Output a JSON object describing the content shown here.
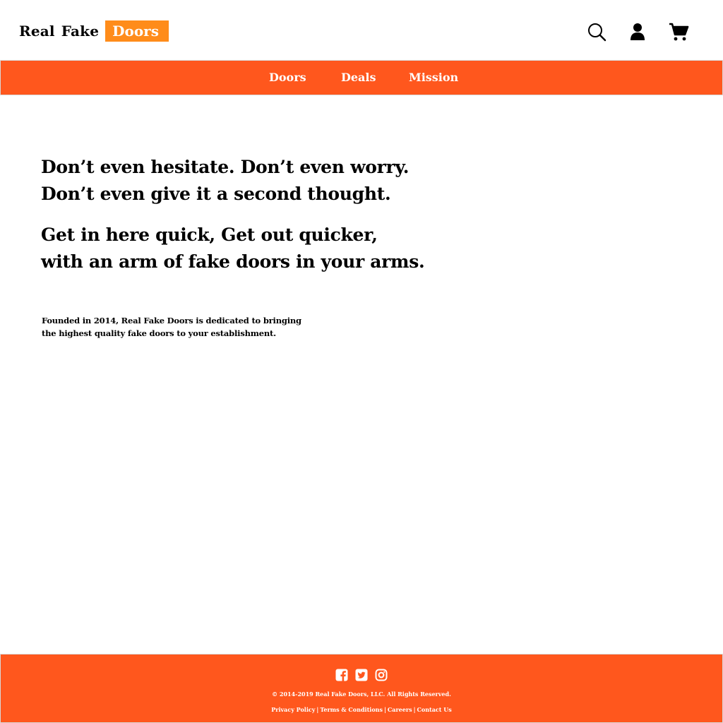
{
  "colors": {
    "accent": "#FF571D",
    "logo_badge": "#FF8C1A",
    "text": "#000000",
    "background": "#FFFFFF"
  },
  "header": {
    "logo": {
      "word1": "Real",
      "word2": "Fake",
      "word3": "Doors"
    },
    "icons": [
      "search-icon",
      "account-icon",
      "cart-icon"
    ]
  },
  "nav": {
    "items": [
      {
        "label": "Doors"
      },
      {
        "label": "Deals"
      },
      {
        "label": "Mission"
      }
    ]
  },
  "hero": {
    "line1": "Don’t even hesitate. Don’t even worry.",
    "line2": "Don’t even give it a second thought.",
    "line3": "Get in here quick, Get out quicker,",
    "line4": "with an arm of fake doors in your arms."
  },
  "about": {
    "line1": "Founded in 2014,  Real Fake Doors is dedicated to bringing",
    "line2": "the highest quality fake doors to your establishment."
  },
  "footer": {
    "social_icons": [
      "facebook-icon",
      "twitter-icon",
      "instagram-icon"
    ],
    "copyright": "© 2014-2019 Real Fake Doors, LLC. All Rights Reserved.",
    "links": [
      {
        "label": "Privacy Policy"
      },
      {
        "label": "Terms & Conditions"
      },
      {
        "label": "Careers"
      },
      {
        "label": "Contact Us"
      }
    ],
    "separator": "|"
  }
}
